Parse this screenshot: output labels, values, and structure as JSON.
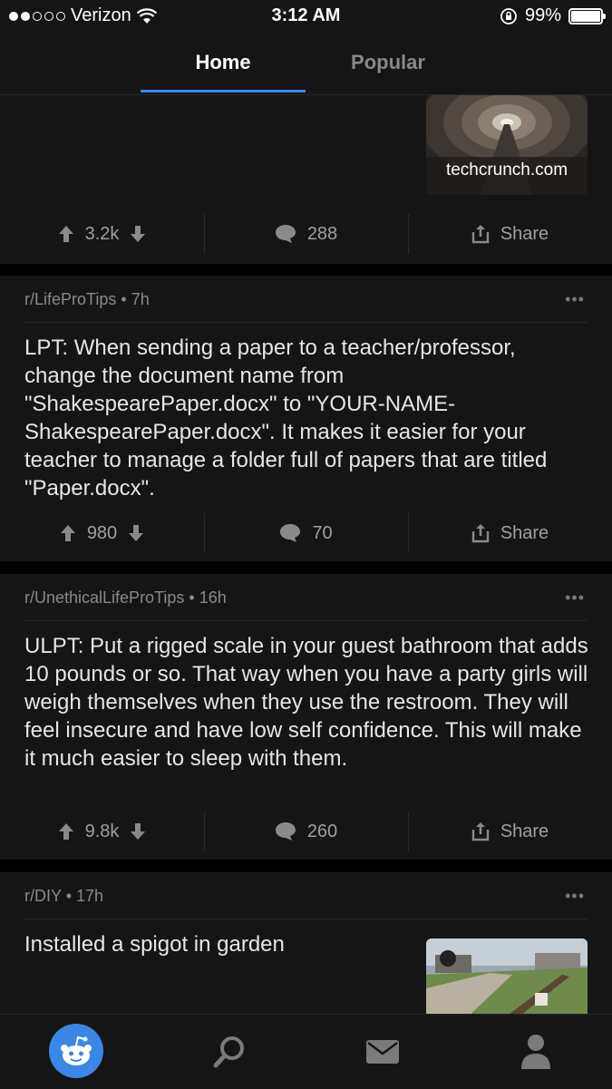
{
  "status_bar": {
    "carrier": "Verizon",
    "time": "3:12 AM",
    "battery": "99%"
  },
  "tabs": [
    {
      "label": "Home",
      "active": true
    },
    {
      "label": "Popular",
      "active": false
    }
  ],
  "posts": [
    {
      "link_domain": "techcrunch.com",
      "upvotes": "3.2k",
      "comments": "288",
      "share_label": "Share"
    },
    {
      "subreddit": "r/LifeProTips",
      "age": "7h",
      "title": "LPT: When sending a paper to a teacher/professor, change the document name from \"ShakespearePaper.docx\" to \"YOUR-NAME-ShakespearePaper.docx\". It makes it easier for your teacher to manage a folder full of papers that are titled \"Paper.docx\".",
      "upvotes": "980",
      "comments": "70",
      "share_label": "Share"
    },
    {
      "subreddit": "r/UnethicalLifeProTips",
      "age": "16h",
      "title": "ULPT: Put a rigged scale in your guest bathroom that adds 10 pounds or so. That way when you have a party girls will weigh themselves when they use the restroom. They will feel insecure and have low self confidence. This will make it much easier to sleep with them.",
      "upvotes": "9.8k",
      "comments": "260",
      "share_label": "Share"
    },
    {
      "subreddit": "r/DIY",
      "age": "17h",
      "title": "Installed a spigot in garden"
    }
  ],
  "colors": {
    "accent": "#3a87e6",
    "background": "#000000",
    "card": "#151515"
  },
  "bottom_nav": [
    "reddit-home-icon",
    "search-icon",
    "inbox-icon",
    "profile-icon"
  ]
}
